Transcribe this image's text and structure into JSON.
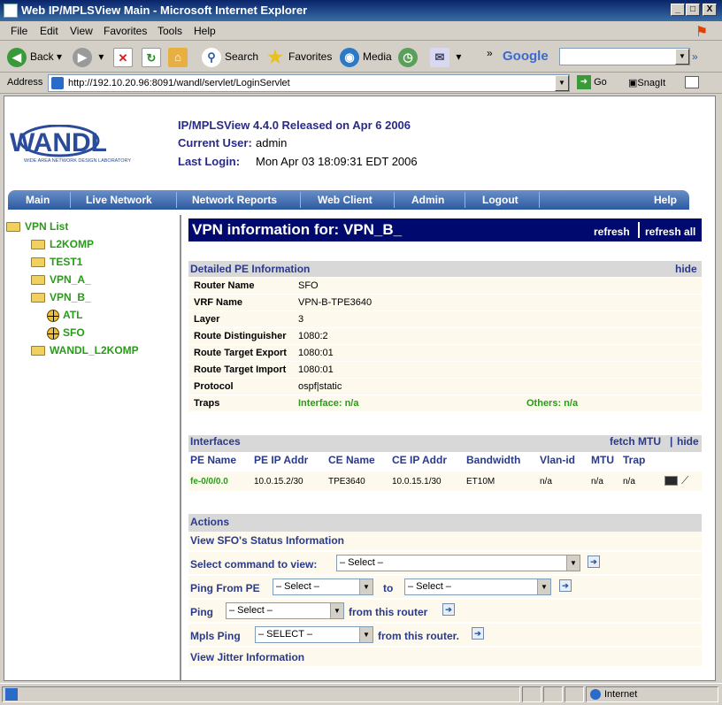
{
  "window": {
    "title": "Web IP/MPLSView Main - Microsoft Internet Explorer",
    "min": "_",
    "max": "□",
    "close": "X"
  },
  "menu": [
    "File",
    "Edit",
    "View",
    "Favorites",
    "Tools",
    "Help"
  ],
  "toolbar": {
    "back": "Back",
    "search": "Search",
    "favorites": "Favorites",
    "media": "Media",
    "google": "Google",
    "more": "»"
  },
  "address": {
    "label": "Address",
    "url": "http://192.10.20.96:8091/wandl/servlet/LoginServlet",
    "go": "Go",
    "snagit": "SnagIt"
  },
  "header": {
    "logo_text": "WANDL",
    "logo_sub": "WIDE AREA NETWORK DESIGN LABORATORY",
    "release": "IP/MPLSView 4.4.0 Released on Apr 6 2006",
    "user_label": "Current User:",
    "user_value": "admin",
    "login_label": "Last Login:",
    "login_value": "Mon Apr 03 18:09:31 EDT 2006"
  },
  "nav": [
    "Main",
    "Live Network",
    "Network Reports",
    "Web Client",
    "Admin",
    "Logout",
    "Help"
  ],
  "tree": {
    "root": "VPN List",
    "items": [
      "L2KOMP",
      "TEST1",
      "VPN_A_",
      "VPN_B_",
      "ATL",
      "SFO",
      "WANDL_L2KOMP"
    ]
  },
  "vpn": {
    "title": "VPN information for: VPN_B_",
    "refresh": "refresh",
    "refresh_all": "refresh all"
  },
  "pe": {
    "heading": "Detailed PE Information",
    "hide": "hide",
    "rows": [
      {
        "k": "Router Name",
        "v": "SFO"
      },
      {
        "k": "VRF Name",
        "v": "VPN-B-TPE3640"
      },
      {
        "k": "Layer",
        "v": "3"
      },
      {
        "k": "Route Distinguisher",
        "v": "1080:2"
      },
      {
        "k": "Route Target Export",
        "v": "1080:01"
      },
      {
        "k": "Route Target Import",
        "v": "1080:01"
      },
      {
        "k": "Protocol",
        "v": "ospf|static"
      }
    ],
    "traps_label": "Traps",
    "traps_interface": "Interface: n/a",
    "traps_others": "Others: n/a"
  },
  "interfaces": {
    "heading": "Interfaces",
    "fetch": "fetch MTU",
    "sep": "|",
    "hide": "hide",
    "columns": [
      "PE Name",
      "PE IP Addr",
      "CE Name",
      "CE IP Addr",
      "Bandwidth",
      "Vlan-id",
      "MTU",
      "Trap"
    ],
    "row": [
      "fe-0/0/0.0",
      "10.0.15.2/30",
      "TPE3640",
      "10.0.15.1/30",
      "ET10M",
      "n/a",
      "n/a",
      "n/a"
    ]
  },
  "actions": {
    "heading": "Actions",
    "status": "View SFO's Status Information",
    "select_cmd": "Select command to view:",
    "select_placeholder": "– Select –",
    "ping_from": "Ping From PE",
    "to": "to",
    "ping": "Ping",
    "from_router": "from this router",
    "mpls_ping": "Mpls Ping",
    "select_upper": "– SELECT –",
    "from_router2": "from this router.",
    "jitter": "View Jitter Information"
  },
  "status": {
    "zone": "Internet"
  }
}
